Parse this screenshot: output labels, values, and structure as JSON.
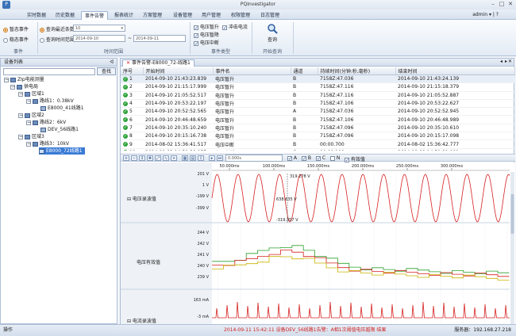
{
  "window": {
    "title": "PQInvestigator",
    "min": "–",
    "max": "□",
    "close": "✕"
  },
  "menu": {
    "items": [
      "实时数据",
      "历史数据",
      "事件告警",
      "报表统计",
      "方案管理",
      "设备管理",
      "用户管理",
      "权限管理",
      "日志管理"
    ],
    "active_index": 2,
    "user": "admin ▾ | ?"
  },
  "ribbon": {
    "event_group": {
      "label": "事件",
      "items": [
        "暂态事件",
        "稳态事件"
      ]
    },
    "time_group": {
      "label": "时间范围",
      "recent_label": "查询最近条数",
      "recent_value": "10",
      "range_label": "查询时间范围",
      "start_date": "2014-09-10",
      "end_date": "2014-09-11",
      "dash": "~"
    },
    "type_group": {
      "label": "事件类型",
      "items": [
        "电压暂升",
        "冲击电流",
        "电压暂降",
        "电压中断"
      ]
    },
    "query_group": {
      "label": "开始查询",
      "button": "查询"
    }
  },
  "left_pane": {
    "title": "设备列表",
    "pin": "ᐊ",
    "search_button": "查找",
    "tree": [
      {
        "label": "ZIp电能测量",
        "level": 0
      },
      {
        "label": "供电局",
        "level": 1
      },
      {
        "label": "区域1",
        "level": 2
      },
      {
        "label": "路线1：0.38kV",
        "level": 3
      },
      {
        "label": "E8000_41线路1",
        "level": 4
      },
      {
        "label": "区域2",
        "level": 2
      },
      {
        "label": "路线2：6kV",
        "level": 3
      },
      {
        "label": "DEV_56线路1",
        "level": 4
      },
      {
        "label": "区域3",
        "level": 2
      },
      {
        "label": "路线3：10kV",
        "level": 3
      },
      {
        "label": "E8000_72线路1",
        "level": 4,
        "selected": true
      }
    ]
  },
  "tab": {
    "label": "事件告警-E8000_72-线路1",
    "close": "✕"
  },
  "events": {
    "headers": [
      "序号",
      "开始时间",
      "事件名",
      "通道",
      "持续时间(分钟:秒,毫秒)",
      "结束时间"
    ],
    "rows": [
      [
        "1",
        "2014-09-10 21:43:23.839",
        "电压暂升",
        "B",
        "7158Z:47.036",
        "2014-09-10 21:43:24.139"
      ],
      [
        "2",
        "2014-09-10 21:15:17.999",
        "电压暂升",
        "B",
        "7158Z:47.116",
        "2014-09-10 21:15:18.379"
      ],
      [
        "3",
        "2014-09-10 21:05:52.517",
        "电压暂升",
        "B",
        "7158Z:47.116",
        "2014-09-10 21:05:52.887"
      ],
      [
        "4",
        "2014-09-10 20:53:22.197",
        "电压暂升",
        "B",
        "7158Z:47.106",
        "2014-09-10 20:53:22.627"
      ],
      [
        "5",
        "2014-09-10 20:52:52.565",
        "电压暂升",
        "A",
        "7158Z:47.036",
        "2014-09-10 20:52:52.945"
      ],
      [
        "6",
        "2014-09-10 20:46:48.659",
        "电压暂升",
        "B",
        "7158Z:47.106",
        "2014-09-10 20:46:48.989"
      ],
      [
        "7",
        "2014-09-10 20:35:10.240",
        "电压暂升",
        "B",
        "7158Z:47.096",
        "2014-09-10 20:35:10.610"
      ],
      [
        "8",
        "2014-09-10 20:15:16.738",
        "电压暂升",
        "B",
        "7158Z:47.096",
        "2014-09-10 20:15:17.098"
      ],
      [
        "9",
        "2014-08-02 15:36:41.517",
        "电压中断",
        "B",
        "00:00.700",
        "2014-08-02 15:36:42.777"
      ],
      [
        "10",
        "2014-08-02 14:51:30.957",
        "电压中断",
        "C",
        "00:00.100",
        "2014-08-02 14:51:31.081"
      ]
    ]
  },
  "wave_toolbar": {
    "time_value": "0.000s",
    "channels": [
      "A",
      "B",
      "C",
      "N"
    ],
    "rms_label": "有效值"
  },
  "waveform": {
    "time_ticks": [
      "50.000ms",
      "100.000ms",
      "150.000ms",
      "200.000ms",
      "250.000ms",
      "300.000ms"
    ],
    "panel1": {
      "label": "电压录波值",
      "ticks": [
        "201 V",
        "1 V",
        "-199 V",
        "-399 V"
      ],
      "top_marker": "319.278 V",
      "mid_marker": "638.635 V",
      "bottom_marker": "-319.357 V"
    },
    "panel2": {
      "label": "电压有效值",
      "ticks": [
        "244 V",
        "242 V",
        "241 V",
        "240 V",
        "239 V"
      ]
    },
    "panel3": {
      "label": "电流录波值",
      "ticks": [
        "163 mA",
        "-3 mA"
      ]
    },
    "colors": {
      "red": "#d62020",
      "green": "#2aa02a",
      "yellow": "#c9b400",
      "grid": "#d8dde5"
    }
  },
  "status": {
    "left": "操作",
    "message": "2014-09-11 15:42:11 设备DEV_56线路1告警：A相1次阈值电压越限 结果",
    "server": "服务器：192.168.27.218"
  }
}
